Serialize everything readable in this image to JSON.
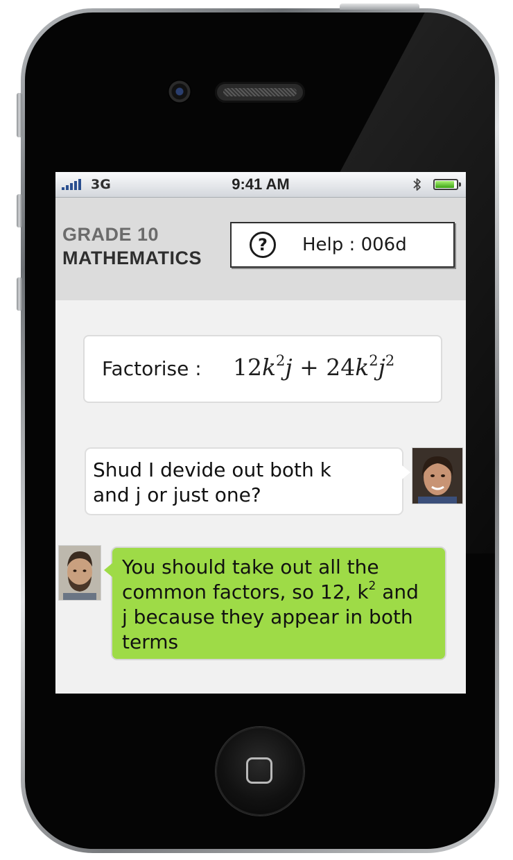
{
  "status_bar": {
    "carrier": "3G",
    "time": "9:41 AM",
    "battery_level": 0.9
  },
  "header": {
    "grade": "GRADE 10",
    "subject": "MATHEMATICS",
    "help_label": "Help : 006d",
    "help_icon_glyph": "?"
  },
  "problem": {
    "prefix": "Factorise :",
    "term1_coef": "12",
    "term1_var1": "k",
    "term1_exp1": "2",
    "term1_var2": "j",
    "operator": "+",
    "term2_coef": "24",
    "term2_var1": "k",
    "term2_exp1": "2",
    "term2_var2": "j",
    "term2_exp2": "2"
  },
  "messages": [
    {
      "sender": "student",
      "line1": "Shud I devide out both k",
      "line2": "and j or just one?"
    },
    {
      "sender": "tutor",
      "line1": "You should take out all the",
      "line2_pre": "common factors, so 12, k",
      "line2_sup": "2",
      "line2_post": " and",
      "line3": "j because they appear in both",
      "line4": "terms"
    }
  ],
  "colors": {
    "tutor_bubble": "#9edb47",
    "student_bubble": "#ffffff",
    "header_bg": "#dcdcdc",
    "screen_bg": "#f1f1f1"
  },
  "icons": {
    "help": "question-circle-icon",
    "bluetooth": "bluetooth-icon",
    "battery": "battery-icon",
    "signal": "signal-bars-icon",
    "home": "home-button-icon"
  }
}
